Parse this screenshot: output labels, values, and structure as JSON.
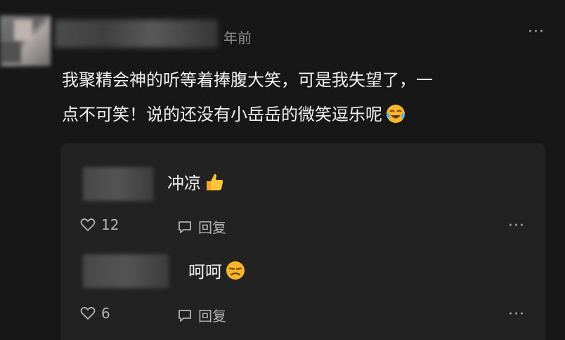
{
  "header": {
    "time": "年前"
  },
  "comment": {
    "line1": "我聚精会神的听等着捧腹大笑，可是我失望了，一",
    "line2": "点不可笑！说的还没有小岳岳的微笑逗乐呢",
    "emoji": "crying-laughing-emoji"
  },
  "replies": [
    {
      "text": "冲凉",
      "emoji": "thumbs-up-emoji",
      "likes": "12",
      "reply_label": "回复"
    },
    {
      "text": "呵呵",
      "emoji": "unamused-face-emoji",
      "likes": "6",
      "reply_label": "回复"
    }
  ],
  "icons": {
    "more": "more-dots-icon",
    "like": "heart-outline-icon",
    "reply": "chat-bubble-icon"
  },
  "colors": {
    "background": "#171717",
    "panel": "#222222",
    "text": "#f0f0f0",
    "muted": "#b3b3b3",
    "emoji_yellow": "#f7b52c"
  }
}
